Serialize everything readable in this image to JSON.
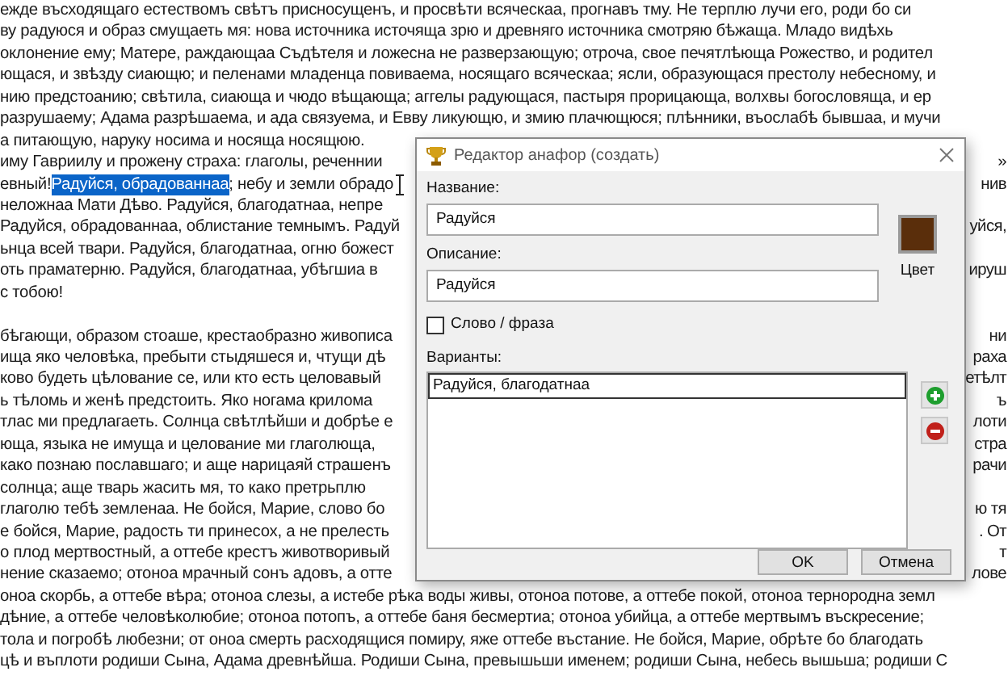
{
  "document": {
    "lines": [
      {
        "kind": "full",
        "text": "ежде въсходящаго естествомъ свѣтъ присносущенъ, и просвѣти всяческаа, прогнавъ тму. Не терплю лучи его, роди бо си"
      },
      {
        "kind": "full",
        "text": "ву радуюся и образ смущаеть мя: нова источника источяща зрю и древняго источника смотряю бѣжаща. Младо видѣхь"
      },
      {
        "kind": "full",
        "text": "оклонение ему; Матере, раждающаа Съдѣтеля и ложесна не разверзающую; отроча, свое печятлѣюща Рожество, и родител"
      },
      {
        "kind": "full",
        "text": "ющася, и звѣзду сиающю; и пеленами младенца повиваема, носящаго всяческаа; ясли, образующася престолу небесному, и"
      },
      {
        "kind": "full",
        "text": "нию предстоанию; свѣтила, сиающа и чюдо вѣщающа; аггелы радующася, пастыря прорицающа, волхвы богословяща, и ер"
      },
      {
        "kind": "full",
        "text": "разрушаему; Адама разрѣшаема, и ада связуема, и Евву ликующю, и змию плачющюся; плѣнники, въослабѣ бывшаа, и мучи"
      },
      {
        "kind": "full",
        "text": "а питающую, наруку носима и носяща носящюю."
      },
      {
        "kind": "split",
        "text": "иму Гавриилу и прожену страха: глаголы, реченнии",
        "right": "»"
      },
      {
        "kind": "split",
        "parts": [
          {
            "text": "евный! ",
            "selected": false
          },
          {
            "text": "Радуйся, обрадованнаа",
            "selected": true
          },
          {
            "text": "; небу и земли обрадо",
            "selected": false
          }
        ],
        "right": "нив"
      },
      {
        "kind": "split",
        "text": "неложнаа Мати Дѣво. Радуйся, благодатнаа, непре"
      },
      {
        "kind": "split",
        "text": "Радуйся, обрадованнаа, облистание темнымъ. Радуй",
        "right": "уйся,"
      },
      {
        "kind": "split",
        "text": "ьнца всей твари. Радуйся, благодатнаа, огню божест"
      },
      {
        "kind": "split",
        "text": "оть праматерню. Радуйся, благодатнаа, убѣгшиа в",
        "right": "ируш"
      },
      {
        "kind": "split",
        "text": "с тобою!"
      },
      {
        "kind": "blank"
      },
      {
        "kind": "split",
        "text": "бѣгающи, образом стоаше, крестаобразно живописа",
        "right": "ни"
      },
      {
        "kind": "split",
        "text": "ища яко человѣка, пребыти стыдяшеся и, чтущи дѣ",
        "right": "раха"
      },
      {
        "kind": "split",
        "text": "ково будеть цѣлование се, или кто есть целовавый",
        "right": "етѣлт"
      },
      {
        "kind": "split",
        "text": "ь тѣломь и женѣ предстоить. Яко ногама крилома",
        "right": "ъ"
      },
      {
        "kind": "split",
        "text": "тлас ми предлагаеть. Солнца свѣтлѣйши и добрѣе е",
        "right": "лоти"
      },
      {
        "kind": "split",
        "text": "юща, языка не имуща и целование ми глаголюща,",
        "right": "стра"
      },
      {
        "kind": "split",
        "text": "како познаю пославшаго; и аще нарицаяй страшенъ",
        "right": "рачи"
      },
      {
        "kind": "split",
        "text": "солнца; аще тварь жасить мя, то како претрьплю"
      },
      {
        "kind": "split",
        "text": "глаголю тебѣ земленаа. Не бойся, Марие, слово бо",
        "right": "ю тя"
      },
      {
        "kind": "split",
        "text": "е бойся, Марие, радость ти принесох, а не прелесть",
        "right": ". От"
      },
      {
        "kind": "split",
        "text": "о плод мертвостный, а оттебе крестъ животворивый",
        "right": "т"
      },
      {
        "kind": "split",
        "text": "нение сказаемо; отоноа мрачный сонъ адовъ, а отте",
        "right": "лове"
      },
      {
        "kind": "full",
        "text": "оноа скорбь, а оттебе вѣра; отоноа слезы, а истебе рѣка воды живы, отоноа потове, а оттебе покой, отоноа тернородна земл"
      },
      {
        "kind": "full",
        "text": "дѣние, а оттебе человѣколюбие; отоноа потопъ, а оттебе баня бесмертиа; отоноа убийца, а оттебе мертвымъ въскресение;"
      },
      {
        "kind": "full",
        "text": "тола и погробѣ любезни; от оноа смерть расходящися помиру, яже оттебе въстание. Не бойся, Марие, обрѣте бо благодать"
      },
      {
        "kind": "full",
        "text": "цѣ и въплоти родиши Сына, Адама древнѣйша. Родиши Сына, превышьши именем; родиши Сына, небесь вышьша; родиши С"
      }
    ]
  },
  "dialog": {
    "title": "Редактор анафор (создать)",
    "name_label": "Название:",
    "name_value": "Радуйся",
    "description_label": "Описание:",
    "description_value": "Радуйся",
    "color": "#5a2e0b",
    "color_label": "Цвет",
    "checkbox": {
      "label": "Слово / фраза",
      "checked": false
    },
    "variants_label": "Варианты:",
    "variants": [
      {
        "text": "Радуйся, благодатнаа",
        "selected": true
      }
    ],
    "buttons": [
      "OK",
      "Отмена"
    ]
  }
}
